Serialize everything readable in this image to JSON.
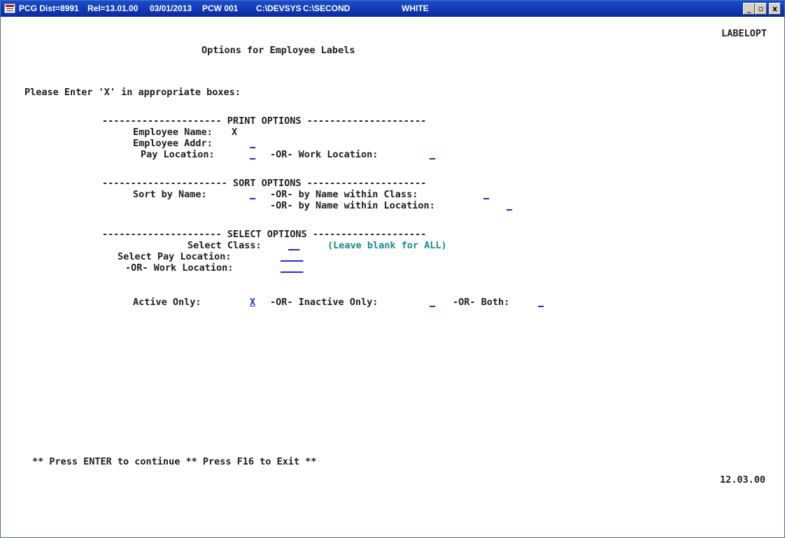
{
  "titlebar": {
    "dist": "PCG Dist=8991",
    "rel": "Rel=13.01.00",
    "date": "03/01/2013",
    "pcw": "PCW 001",
    "path1": "C:\\DEVSYS",
    "path2": "C:\\SECOND",
    "color": "WHITE",
    "minimize": "_",
    "restore": "▫",
    "close": "x"
  },
  "screen": {
    "program_id": "LABELOPT",
    "title": "Options for Employee Labels",
    "instruction": "Please Enter 'X' in appropriate boxes:",
    "print_header": "--------------------- PRINT OPTIONS ---------------------",
    "employee_name_label": "Employee Name:",
    "employee_name_value": "X",
    "employee_addr_label": "Employee Addr:",
    "employee_addr_value": "_",
    "pay_location_label": "Pay Location:",
    "pay_location_value": "_",
    "or_work_location_label": "-OR- Work Location:",
    "work_location_value": "_",
    "sort_header": "---------------------- SORT OPTIONS ---------------------",
    "sort_by_name_label": "Sort by Name:",
    "sort_by_name_value": "_",
    "by_name_class_label": "-OR- by Name within Class:",
    "by_name_class_value": "_",
    "by_name_location_label": "-OR- by Name within Location:",
    "by_name_location_value": "_",
    "select_header": "--------------------- SELECT OPTIONS --------------------",
    "select_class_label": "Select Class:",
    "select_class_value": "__",
    "select_class_hint": "(Leave blank for ALL)",
    "select_pay_location_label": "Select Pay Location:",
    "select_pay_location_value": "____",
    "or_work_location2_label": "-OR- Work Location:",
    "select_work_location_value": "____",
    "active_only_label": "Active Only:",
    "active_only_value": "X",
    "inactive_only_label": "-OR- Inactive Only:",
    "inactive_only_value": "_",
    "both_label": "-OR- Both:",
    "both_value": "_",
    "footer": "** Press ENTER to continue ** Press F16 to Exit **",
    "version": "12.03.00"
  },
  "colors": {
    "titlebar": "#0a2a9c",
    "field": "#1a2fcc",
    "hint": "#1a8a8a",
    "text": "#1c1c24"
  }
}
